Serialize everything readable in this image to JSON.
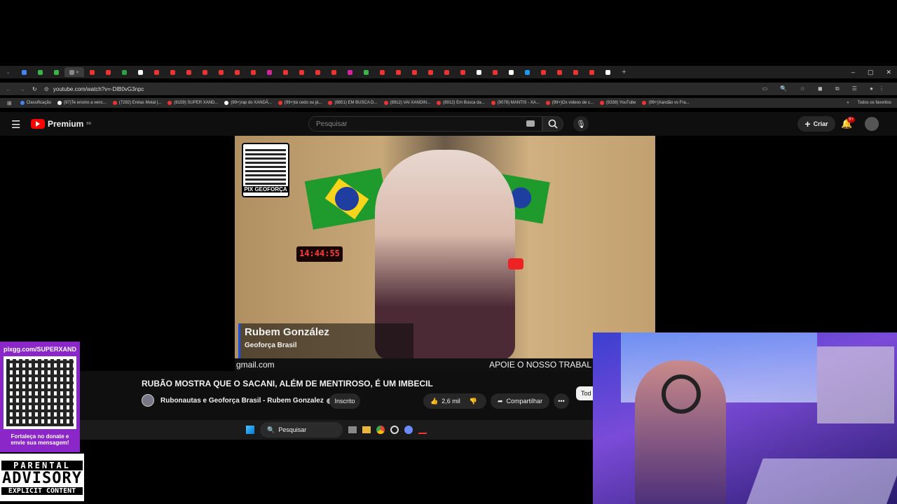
{
  "browser": {
    "url": "youtube.com/watch?v=-DlB0vG3npc",
    "bookmarks": [
      "Classificação",
      "(97)Te ensino a venc...",
      "(7292) Erelas Metal |...",
      "(8159) SUPER XAND...",
      "(99+)rap do XANDÃ...",
      "(99+)tá cedo ou já...",
      "(8851) EM BUSCA D...",
      "(8912) VAI XANDIN...",
      "(8912) Em Busca da...",
      "(9078) MANTIS - XA...",
      "(99+)Os vídeos de c...",
      "(9338) YouTube",
      "(99+)Xandão vs Fra..."
    ],
    "all_bookmarks": "Todos os favoritos"
  },
  "youtube": {
    "logo": "Premium",
    "logo_sup": "BR",
    "search_placeholder": "Pesquisar",
    "create": "Criar",
    "notif_count": "9+"
  },
  "video": {
    "qr_caption": "PIX GEOFORÇA",
    "clock": "14:44:55",
    "name": "Rubem González",
    "channel_tag": "Geoforça Brasil",
    "email_scroll": "gmail.com",
    "support_scroll": "APOIE O NOSSO TRABAL",
    "title": "RUBÃO MOSTRA QUE O SACANI, ALÉM DE MENTIROSO, É UM IMBECIL",
    "channel": "Rubonautas e Geoforça Brasil - Rubem Gonzalez",
    "subscribed": "Inscrito",
    "likes": "2,6 mil",
    "share": "Compartilhar",
    "side_chip": "Tod"
  },
  "taskbar": {
    "search": "Pesquisar"
  },
  "overlay": {
    "pix_url": "pixgg.com/SUPERXAND",
    "donate_line1": "Fortaleça no donate e",
    "donate_line2": "envie sua mensagem!",
    "advisory1": "PARENTAL",
    "advisory2": "ADVISORY",
    "advisory3": "EXPLICIT CONTENT"
  }
}
